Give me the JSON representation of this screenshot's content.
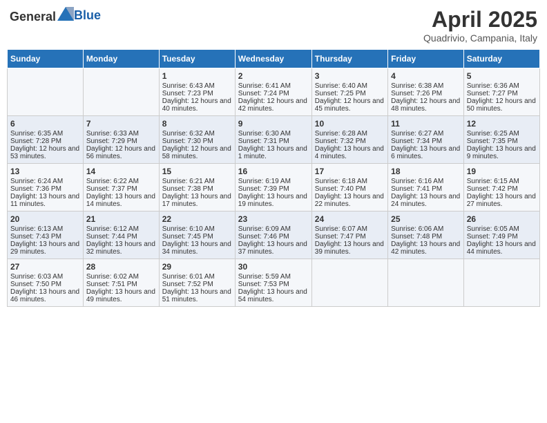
{
  "header": {
    "logo_general": "General",
    "logo_blue": "Blue",
    "month_title": "April 2025",
    "subtitle": "Quadrivio, Campania, Italy"
  },
  "days_of_week": [
    "Sunday",
    "Monday",
    "Tuesday",
    "Wednesday",
    "Thursday",
    "Friday",
    "Saturday"
  ],
  "weeks": [
    [
      {
        "day": "",
        "content": ""
      },
      {
        "day": "",
        "content": ""
      },
      {
        "day": "1",
        "content": "Sunrise: 6:43 AM\nSunset: 7:23 PM\nDaylight: 12 hours and 40 minutes."
      },
      {
        "day": "2",
        "content": "Sunrise: 6:41 AM\nSunset: 7:24 PM\nDaylight: 12 hours and 42 minutes."
      },
      {
        "day": "3",
        "content": "Sunrise: 6:40 AM\nSunset: 7:25 PM\nDaylight: 12 hours and 45 minutes."
      },
      {
        "day": "4",
        "content": "Sunrise: 6:38 AM\nSunset: 7:26 PM\nDaylight: 12 hours and 48 minutes."
      },
      {
        "day": "5",
        "content": "Sunrise: 6:36 AM\nSunset: 7:27 PM\nDaylight: 12 hours and 50 minutes."
      }
    ],
    [
      {
        "day": "6",
        "content": "Sunrise: 6:35 AM\nSunset: 7:28 PM\nDaylight: 12 hours and 53 minutes."
      },
      {
        "day": "7",
        "content": "Sunrise: 6:33 AM\nSunset: 7:29 PM\nDaylight: 12 hours and 56 minutes."
      },
      {
        "day": "8",
        "content": "Sunrise: 6:32 AM\nSunset: 7:30 PM\nDaylight: 12 hours and 58 minutes."
      },
      {
        "day": "9",
        "content": "Sunrise: 6:30 AM\nSunset: 7:31 PM\nDaylight: 13 hours and 1 minute."
      },
      {
        "day": "10",
        "content": "Sunrise: 6:28 AM\nSunset: 7:32 PM\nDaylight: 13 hours and 4 minutes."
      },
      {
        "day": "11",
        "content": "Sunrise: 6:27 AM\nSunset: 7:34 PM\nDaylight: 13 hours and 6 minutes."
      },
      {
        "day": "12",
        "content": "Sunrise: 6:25 AM\nSunset: 7:35 PM\nDaylight: 13 hours and 9 minutes."
      }
    ],
    [
      {
        "day": "13",
        "content": "Sunrise: 6:24 AM\nSunset: 7:36 PM\nDaylight: 13 hours and 11 minutes."
      },
      {
        "day": "14",
        "content": "Sunrise: 6:22 AM\nSunset: 7:37 PM\nDaylight: 13 hours and 14 minutes."
      },
      {
        "day": "15",
        "content": "Sunrise: 6:21 AM\nSunset: 7:38 PM\nDaylight: 13 hours and 17 minutes."
      },
      {
        "day": "16",
        "content": "Sunrise: 6:19 AM\nSunset: 7:39 PM\nDaylight: 13 hours and 19 minutes."
      },
      {
        "day": "17",
        "content": "Sunrise: 6:18 AM\nSunset: 7:40 PM\nDaylight: 13 hours and 22 minutes."
      },
      {
        "day": "18",
        "content": "Sunrise: 6:16 AM\nSunset: 7:41 PM\nDaylight: 13 hours and 24 minutes."
      },
      {
        "day": "19",
        "content": "Sunrise: 6:15 AM\nSunset: 7:42 PM\nDaylight: 13 hours and 27 minutes."
      }
    ],
    [
      {
        "day": "20",
        "content": "Sunrise: 6:13 AM\nSunset: 7:43 PM\nDaylight: 13 hours and 29 minutes."
      },
      {
        "day": "21",
        "content": "Sunrise: 6:12 AM\nSunset: 7:44 PM\nDaylight: 13 hours and 32 minutes."
      },
      {
        "day": "22",
        "content": "Sunrise: 6:10 AM\nSunset: 7:45 PM\nDaylight: 13 hours and 34 minutes."
      },
      {
        "day": "23",
        "content": "Sunrise: 6:09 AM\nSunset: 7:46 PM\nDaylight: 13 hours and 37 minutes."
      },
      {
        "day": "24",
        "content": "Sunrise: 6:07 AM\nSunset: 7:47 PM\nDaylight: 13 hours and 39 minutes."
      },
      {
        "day": "25",
        "content": "Sunrise: 6:06 AM\nSunset: 7:48 PM\nDaylight: 13 hours and 42 minutes."
      },
      {
        "day": "26",
        "content": "Sunrise: 6:05 AM\nSunset: 7:49 PM\nDaylight: 13 hours and 44 minutes."
      }
    ],
    [
      {
        "day": "27",
        "content": "Sunrise: 6:03 AM\nSunset: 7:50 PM\nDaylight: 13 hours and 46 minutes."
      },
      {
        "day": "28",
        "content": "Sunrise: 6:02 AM\nSunset: 7:51 PM\nDaylight: 13 hours and 49 minutes."
      },
      {
        "day": "29",
        "content": "Sunrise: 6:01 AM\nSunset: 7:52 PM\nDaylight: 13 hours and 51 minutes."
      },
      {
        "day": "30",
        "content": "Sunrise: 5:59 AM\nSunset: 7:53 PM\nDaylight: 13 hours and 54 minutes."
      },
      {
        "day": "",
        "content": ""
      },
      {
        "day": "",
        "content": ""
      },
      {
        "day": "",
        "content": ""
      }
    ]
  ]
}
